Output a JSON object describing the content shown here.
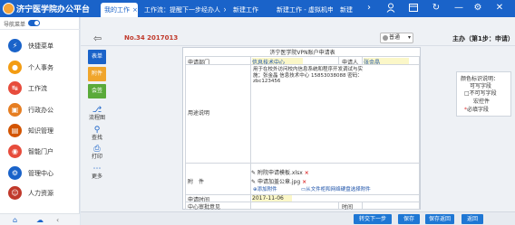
{
  "app": {
    "title": "济宁医学院办公平台"
  },
  "tabs": [
    {
      "label": "我的工作",
      "active": true
    },
    {
      "label": "工作流：提醒下一步经办人",
      "active": false
    },
    {
      "label": "新建工作",
      "active": false
    },
    {
      "label": "新建工作 - 虚拟机申请",
      "active": false
    },
    {
      "label": "新建",
      "active": false
    }
  ],
  "topbar_icons": [
    "user-icon",
    "calendar-icon",
    "refresh-icon",
    "minimize-icon",
    "settings-icon",
    "close-icon"
  ],
  "sidebar": {
    "toggle_label": "导航菜单",
    "toggle_on": true,
    "items": [
      {
        "label": "快捷菜单",
        "icon": "lightning-icon",
        "color": "#1a63c9"
      },
      {
        "label": "个人事务",
        "icon": "person-icon",
        "color": "#f39c12"
      },
      {
        "label": "工作流",
        "icon": "workflow-icon",
        "color": "#e74c3c"
      },
      {
        "label": "行政办公",
        "icon": "office-icon",
        "color": "#e67e22"
      },
      {
        "label": "知识管理",
        "icon": "book-icon",
        "color": "#d35400"
      },
      {
        "label": "智能门户",
        "icon": "portal-icon",
        "color": "#e74c3c"
      },
      {
        "label": "管理中心",
        "icon": "gear-icon",
        "color": "#1a63c9"
      },
      {
        "label": "人力资源",
        "icon": "team-icon",
        "color": "#c0392b"
      }
    ]
  },
  "breadbar": {
    "docno_label": "No.",
    "docno_value": "34 2017013",
    "priority": "普通",
    "host_label": "主办（第1步：申请）"
  },
  "actionbar": {
    "buttons": [
      {
        "label": "表单",
        "color": "#1a63c9"
      },
      {
        "label": "附件",
        "color": "#f0a52b"
      },
      {
        "label": "会签",
        "color": "#5aaa3a"
      }
    ],
    "tools": [
      {
        "label": "流程图",
        "icon": "flowchart-icon"
      },
      {
        "label": "查找",
        "icon": "search-icon"
      },
      {
        "label": "打印",
        "icon": "print-icon"
      },
      {
        "label": "更多",
        "icon": "more-icon"
      }
    ]
  },
  "form": {
    "title": "济宁医学院VPN账户申请表",
    "dept_label": "申请部门",
    "dept_value": "信息技术中心",
    "applicant_label": "申请人",
    "applicant_value": "张金晶",
    "desc_label": "用途说明",
    "desc_text": "用于在校外访问校内信息系统和程序开发调试与实施；张金晶 信息技术中心 15853038088 密码：zbc123456",
    "attach_label": "附　件",
    "files": [
      "附院申请模板.xlsx",
      "申请加盖公章.jpg"
    ],
    "file_links": [
      "添加附件",
      "从文件柜和网络硬盘选择附件"
    ],
    "date_label": "申请时间",
    "date_value": "2017-11-06",
    "approver_label": "中心审批意见",
    "time_label": "时间"
  },
  "legend": {
    "title": "颜色标识说明：",
    "items": [
      "可写字段",
      "不可写字段",
      "宏控件",
      "必填字段"
    ]
  },
  "footer": {
    "buttons": [
      "转交下一步",
      "保存",
      "保存返回",
      "返回"
    ]
  }
}
